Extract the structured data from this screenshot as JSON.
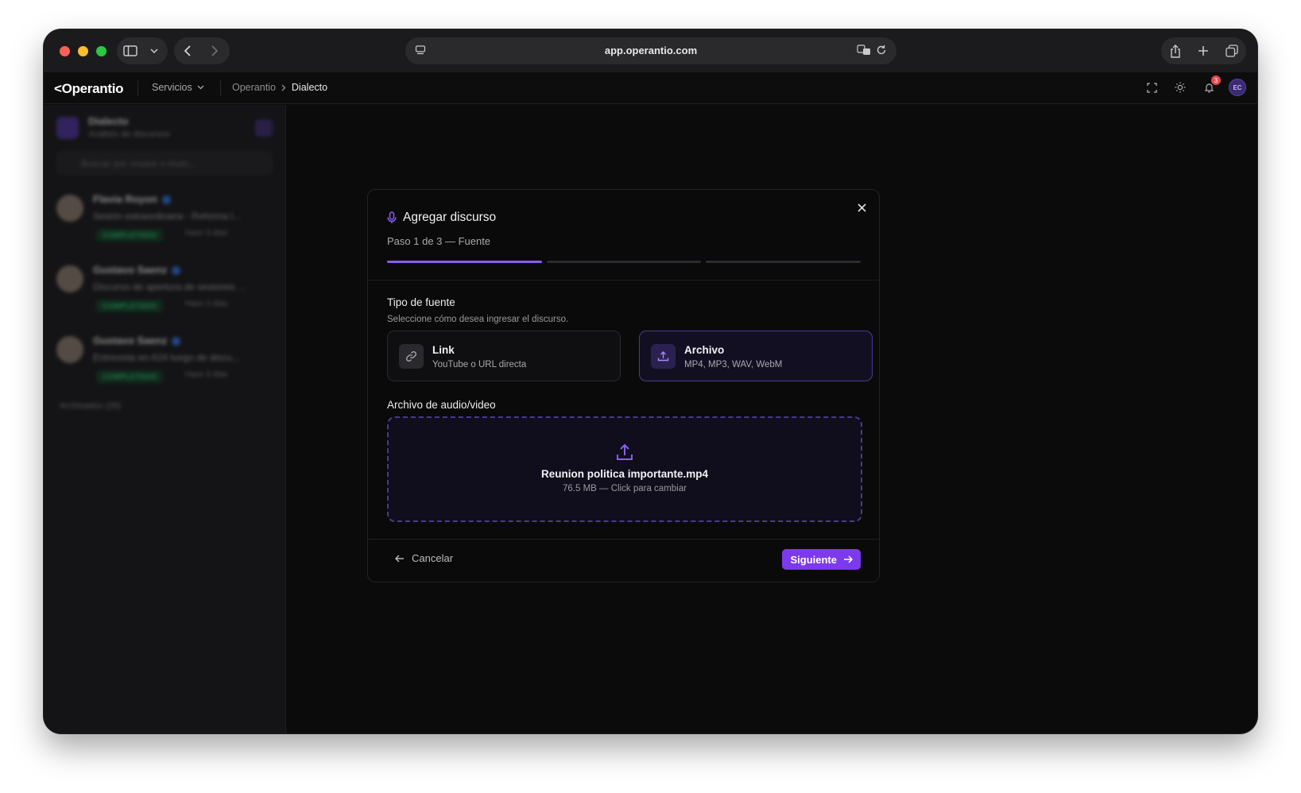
{
  "browser": {
    "url": "app.operantio.com"
  },
  "app": {
    "logo": "Operantio",
    "services_label": "Servicios",
    "breadcrumb": [
      "Operantio",
      "Dialecto"
    ],
    "notification_count": "3",
    "user_initials": "EC"
  },
  "sidebar": {
    "title": "Dialecto",
    "subtitle": "Análisis de discursos",
    "search_placeholder": "Buscar por orador o título...",
    "items": [
      {
        "name": "Flavia Royon",
        "desc": "Sesión extraordinaria - Reforma l...",
        "status": "COMPLETADO",
        "time": "Hace 3 días"
      },
      {
        "name": "Gustavo Saenz",
        "desc": "Discurso de apertura de sesiones ...",
        "status": "COMPLETADO",
        "time": "Hace 3 días"
      },
      {
        "name": "Gustavo Saenz",
        "desc": "Entrevista en A24 luego de discu...",
        "status": "COMPLETADO",
        "time": "Hace 3 días"
      }
    ],
    "archived_label": "Archivados (26)"
  },
  "dialog": {
    "title": "Agregar discurso",
    "step": "Paso 1 de 3 — Fuente",
    "progress_current_step": 1,
    "progress_total_steps": 3,
    "source_type_label": "Tipo de fuente",
    "source_type_hint": "Seleccione cómo desea ingresar el discurso.",
    "options": [
      {
        "title": "Link",
        "subtitle": "YouTube o URL directa",
        "selected": false
      },
      {
        "title": "Archivo",
        "subtitle": "MP4, MP3, WAV, WebM",
        "selected": true
      }
    ],
    "file_section_label": "Archivo de audio/video",
    "file_name": "Reunion politica importante.mp4",
    "file_meta": "76.5 MB — Click para cambiar",
    "cancel_label": "Cancelar",
    "next_label": "Siguiente"
  },
  "colors": {
    "accent": "#8b5cf6",
    "button": "#7c3aed",
    "background": "#0b0b0c",
    "success": "#2ecc71"
  }
}
